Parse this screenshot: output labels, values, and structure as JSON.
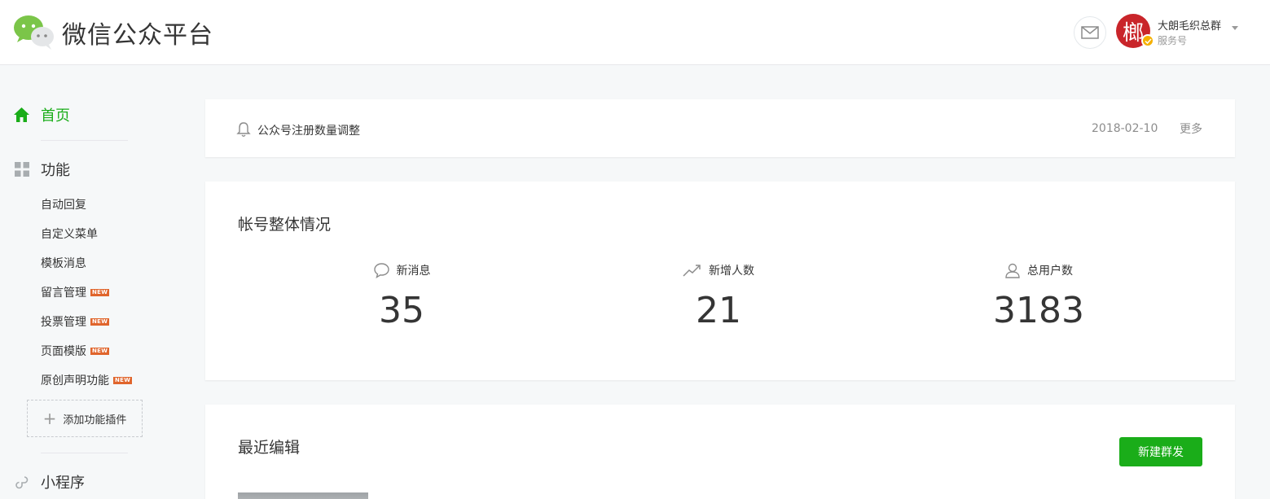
{
  "header": {
    "brand": "微信公众平台",
    "account_name": "大朗毛织总群",
    "account_type": "服务号",
    "avatar_glyph": "榔"
  },
  "sidebar": {
    "home_label": "首页",
    "function_label": "功能",
    "items": [
      {
        "label": "自动回复",
        "badge": ""
      },
      {
        "label": "自定义菜单",
        "badge": ""
      },
      {
        "label": "模板消息",
        "badge": ""
      },
      {
        "label": "留言管理",
        "badge": "NEW"
      },
      {
        "label": "投票管理",
        "badge": "NEW"
      },
      {
        "label": "页面模版",
        "badge": "NEW"
      },
      {
        "label": "原创声明功能",
        "badge": "NEW"
      }
    ],
    "add_plugin_label": "添加功能插件",
    "miniprogram_label": "小程序"
  },
  "notice": {
    "text": "公众号注册数量调整",
    "date": "2018-02-10",
    "more": "更多"
  },
  "overview": {
    "title": "帐号整体情况",
    "stats": [
      {
        "label": "新消息",
        "value": "35",
        "icon": "message-bubble-icon"
      },
      {
        "label": "新增人数",
        "value": "21",
        "icon": "trend-up-icon"
      },
      {
        "label": "总用户数",
        "value": "3183",
        "icon": "user-icon"
      }
    ]
  },
  "recent": {
    "title": "最近编辑",
    "new_button": "新建群发"
  },
  "colors": {
    "accent": "#1aad19",
    "badge": "#e0652c",
    "avatar": "#c9252a"
  }
}
